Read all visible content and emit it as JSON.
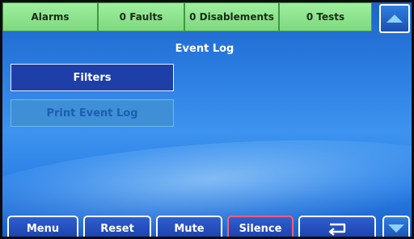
{
  "status_bar": {
    "alarms": "Alarms",
    "faults": "0 Faults",
    "disablements": "0 Disablements",
    "tests": "0 Tests"
  },
  "title": "Event Log",
  "menu": {
    "filters": "Filters",
    "print_event_log": "Print Event Log"
  },
  "bottom_bar": {
    "menu": "Menu",
    "reset": "Reset",
    "mute": "Mute",
    "silence": "Silence"
  },
  "icons": {
    "scroll_up": "arrow-up-icon",
    "scroll_down": "arrow-down-icon",
    "back": "return-arrow-icon"
  },
  "colors": {
    "status_green": "#8ee68e",
    "button_blue": "#1e3ea8",
    "silence_border": "#ff5c7a"
  }
}
